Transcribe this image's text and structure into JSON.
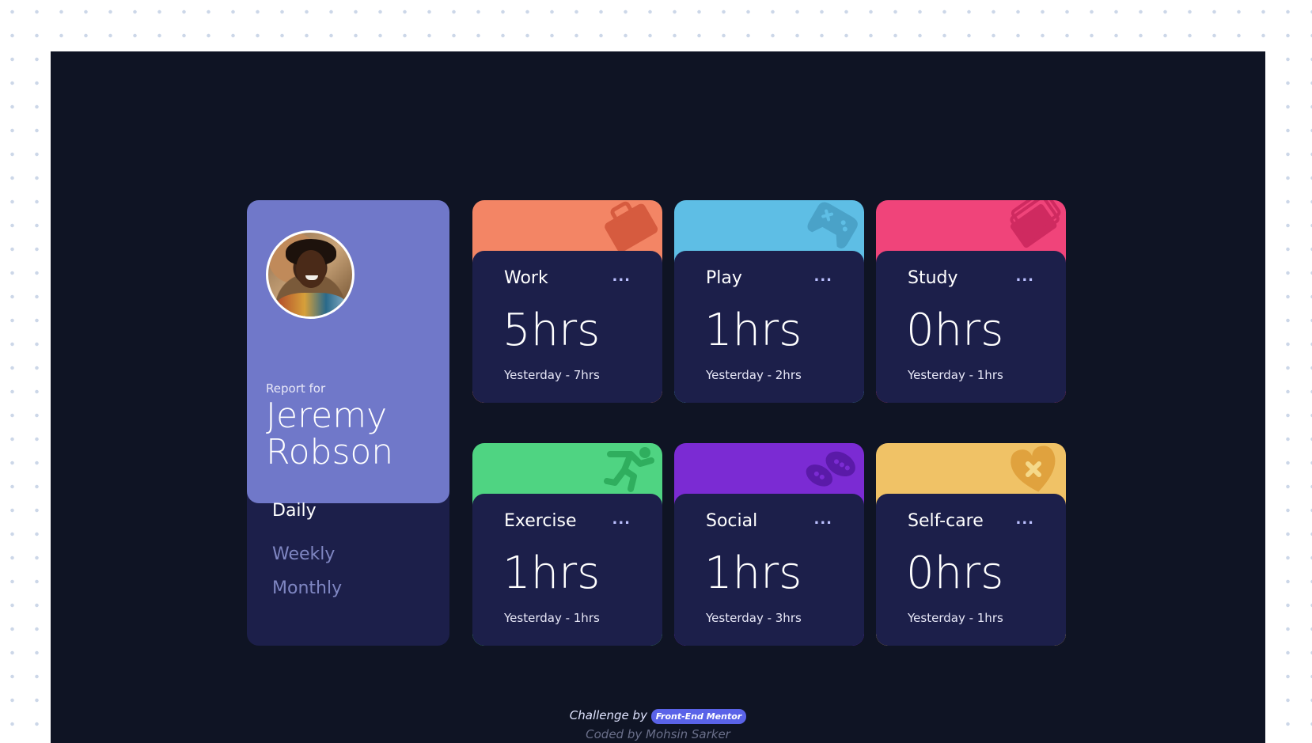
{
  "profile": {
    "report_label": "Report for",
    "name": "Jeremy Robson",
    "timeframes": [
      "Daily",
      "Weekly",
      "Monthly"
    ],
    "active": "Daily"
  },
  "cards": [
    {
      "title": "Work",
      "current": "5hrs",
      "previous": "Yesterday - 7hrs",
      "color": "#f38565",
      "icon": "briefcase-icon"
    },
    {
      "title": "Play",
      "current": "1hrs",
      "previous": "Yesterday - 2hrs",
      "color": "#5ebee5",
      "icon": "gamepad-icon"
    },
    {
      "title": "Study",
      "current": "0hrs",
      "previous": "Yesterday - 1hrs",
      "color": "#f0447a",
      "icon": "books-icon"
    },
    {
      "title": "Exercise",
      "current": "1hrs",
      "previous": "Yesterday - 1hrs",
      "color": "#4fd482",
      "icon": "runner-icon"
    },
    {
      "title": "Social",
      "current": "1hrs",
      "previous": "Yesterday - 3hrs",
      "color": "#7b2bd3",
      "icon": "chat-bubbles-icon"
    },
    {
      "title": "Self-care",
      "current": "0hrs",
      "previous": "Yesterday - 1hrs",
      "color": "#f0c266",
      "icon": "heart-icon"
    }
  ],
  "card_menu_label": "...",
  "footer": {
    "challenge_by": "Challenge by",
    "frontend_mentor": "Front-End Mentor",
    "coded_by": "Coded by Mohsin Sarker"
  }
}
